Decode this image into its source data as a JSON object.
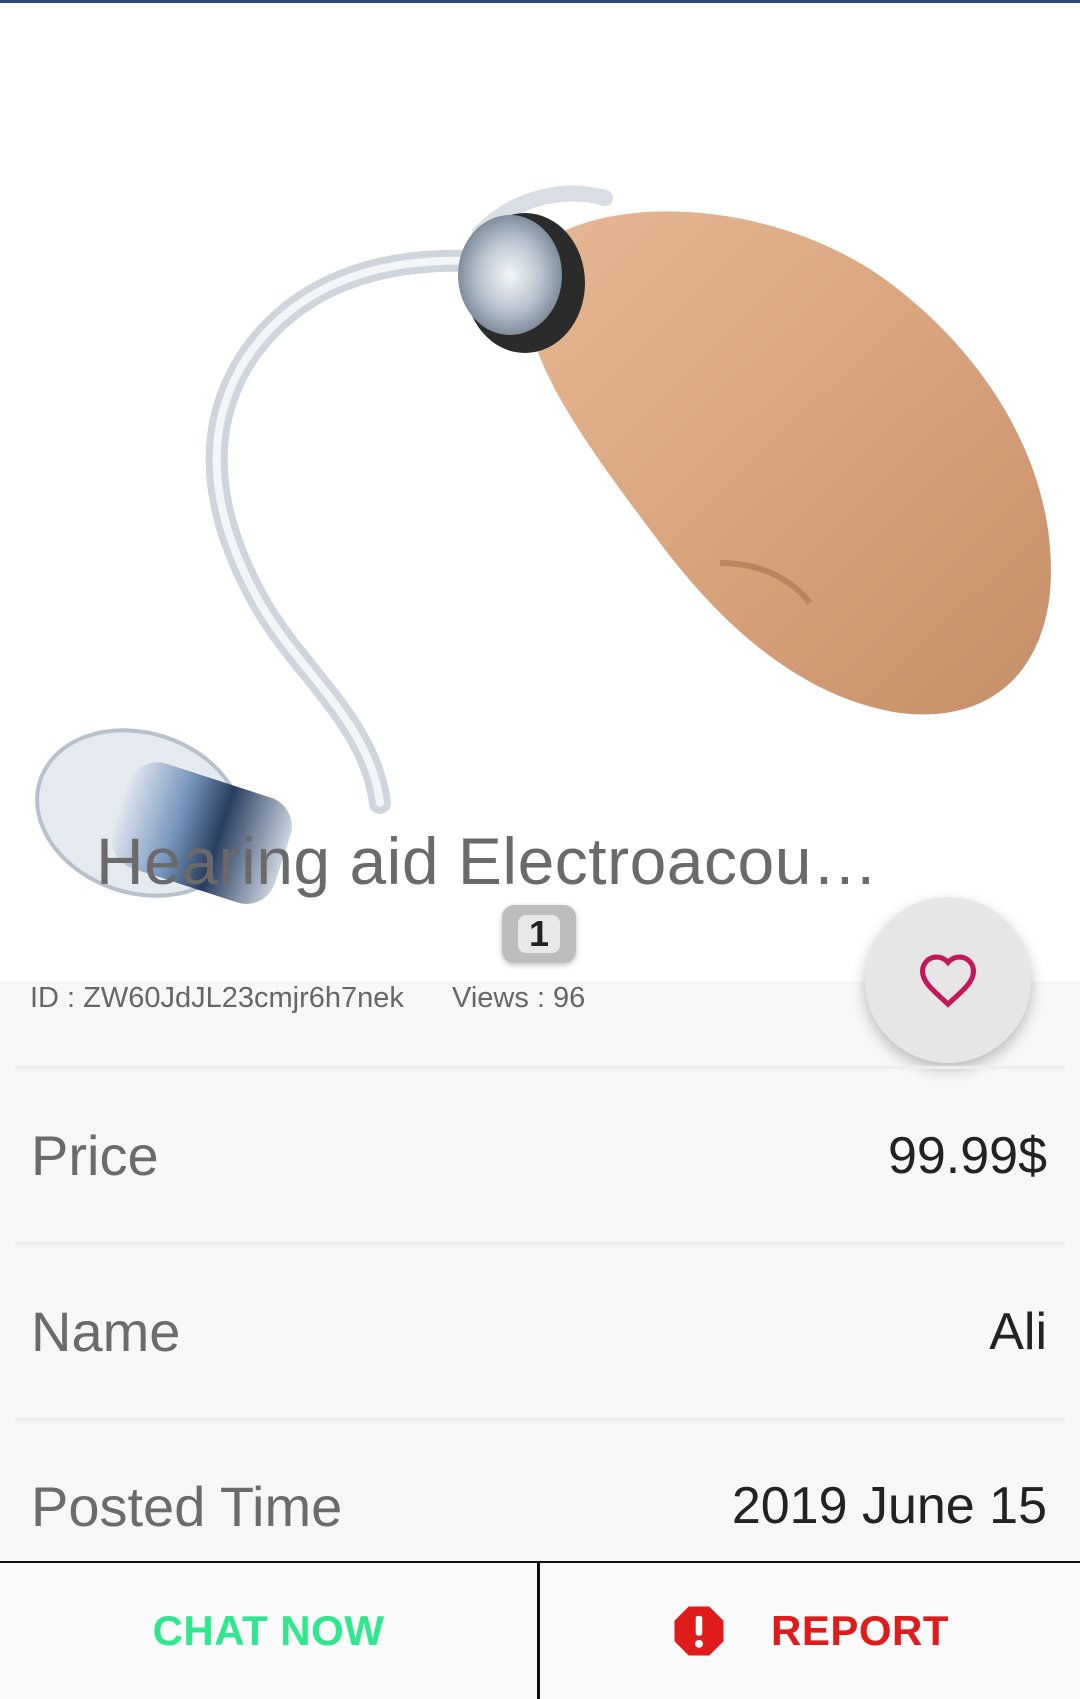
{
  "listing": {
    "title": "Hearing aid   Electroacou…",
    "image_page": "1",
    "id_text": "ID : ZW60JdJL23cmjr6h7nek",
    "views_text": "Views : 96"
  },
  "details": [
    {
      "label": "Price",
      "value": "99.99$"
    },
    {
      "label": "Name",
      "value": "Ali"
    },
    {
      "label": "Posted Time",
      "value": "2019 June 15"
    }
  ],
  "actions": {
    "chat_label": "CHAT NOW",
    "report_label": "REPORT"
  },
  "icons": {
    "favorite": "heart-outline-icon",
    "report": "alert-octagon-icon"
  },
  "colors": {
    "chat": "#2ee88e",
    "report": "#e01b1b",
    "favorite": "#c2185b"
  }
}
